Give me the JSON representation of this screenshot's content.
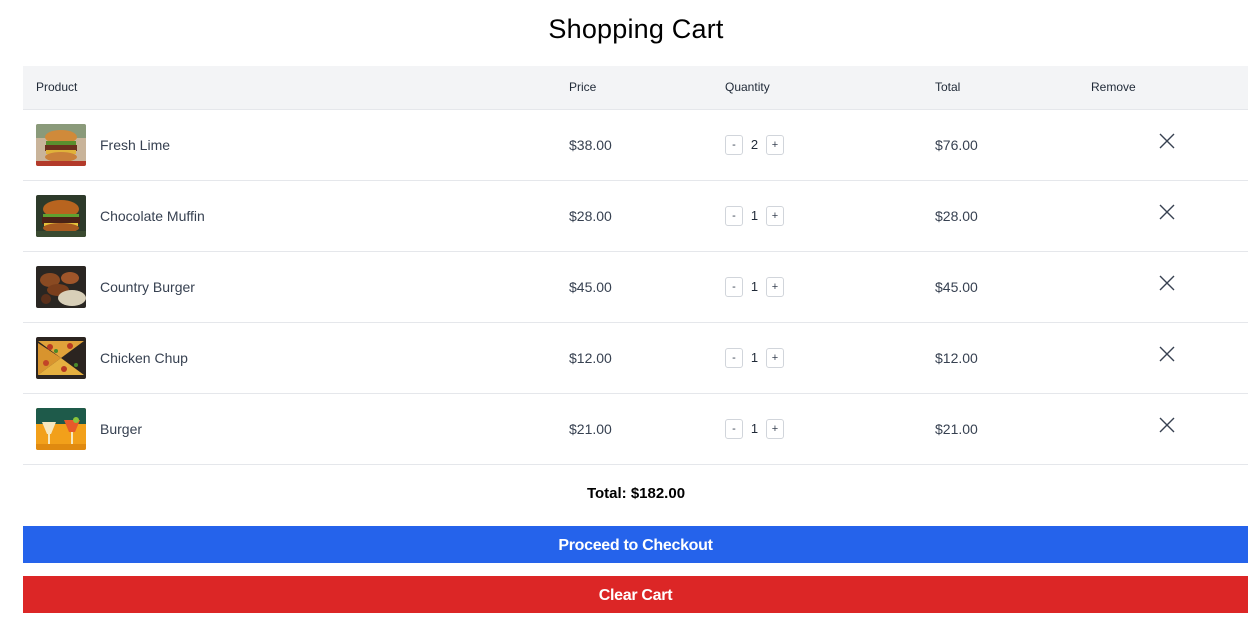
{
  "page": {
    "title": "Shopping Cart"
  },
  "table": {
    "headers": {
      "product": "Product",
      "price": "Price",
      "quantity": "Quantity",
      "total": "Total",
      "remove": "Remove"
    },
    "rows": [
      {
        "name": "Fresh Lime",
        "price": "$38.00",
        "quantity": "2",
        "total": "$76.00",
        "image": "burger-photo"
      },
      {
        "name": "Chocolate Muffin",
        "price": "$28.00",
        "quantity": "1",
        "total": "$28.00",
        "image": "burger-photo"
      },
      {
        "name": "Country Burger",
        "price": "$45.00",
        "quantity": "1",
        "total": "$45.00",
        "image": "grill-photo"
      },
      {
        "name": "Chicken Chup",
        "price": "$12.00",
        "quantity": "1",
        "total": "$12.00",
        "image": "pizza-photo"
      },
      {
        "name": "Burger",
        "price": "$21.00",
        "quantity": "1",
        "total": "$21.00",
        "image": "drinks-photo"
      }
    ],
    "decrement_label": "-",
    "increment_label": "+",
    "remove_icon": "close-icon"
  },
  "summary": {
    "total_label": "Total: $182.00"
  },
  "actions": {
    "checkout_label": "Proceed to Checkout",
    "clear_label": "Clear Cart"
  },
  "colors": {
    "checkout": "#2563eb",
    "clear": "#dc2626",
    "header_bg": "#f3f4f6"
  }
}
